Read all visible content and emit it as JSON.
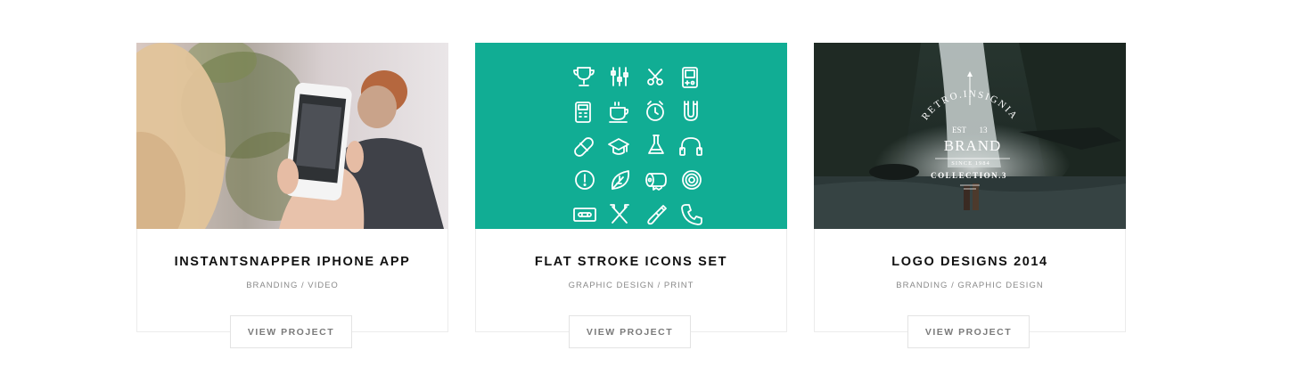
{
  "colors": {
    "teal": "#11ad94",
    "title": "#111111",
    "tags": "#8a8a8a",
    "button_text": "#7a7a7a",
    "border": "#ececec"
  },
  "projects": [
    {
      "title": "INSTANTSNAPPER IPHONE APP",
      "tags": "BRANDING / VIDEO",
      "button_label": "VIEW PROJECT",
      "image": "person-photographing-with-iphone"
    },
    {
      "title": "FLAT STROKE ICONS SET",
      "tags": "GRAPHIC DESIGN / PRINT",
      "button_label": "VIEW PROJECT",
      "image": "teal-stroke-icons-grid",
      "icons": [
        "trophy-icon",
        "sliders-icon",
        "scissors-icon",
        "gameboy-icon",
        "calculator-icon",
        "coffee-cup-icon",
        "alarm-clock-icon",
        "magnet-icon",
        "pill-icon",
        "graduation-cap-icon",
        "flask-icon",
        "headphones-icon",
        "alert-icon",
        "leaf-icon",
        "paper-roll-icon",
        "target-icon",
        "cassette-icon",
        "cross-tools-icon",
        "paintbrush-icon",
        "phone-icon"
      ]
    },
    {
      "title": "LOGO DESIGNS 2014",
      "tags": "BRANDING / GRAPHIC DESIGN",
      "button_label": "VIEW PROJECT",
      "image": "waterfall-with-retro-insignia",
      "insignia": {
        "arc_text": "RETRO.INSIGNIA",
        "est": "EST",
        "est_num": "13",
        "brand": "BRAND",
        "since": "SINCE 1984",
        "collection": "COLLECTION.3"
      }
    }
  ]
}
